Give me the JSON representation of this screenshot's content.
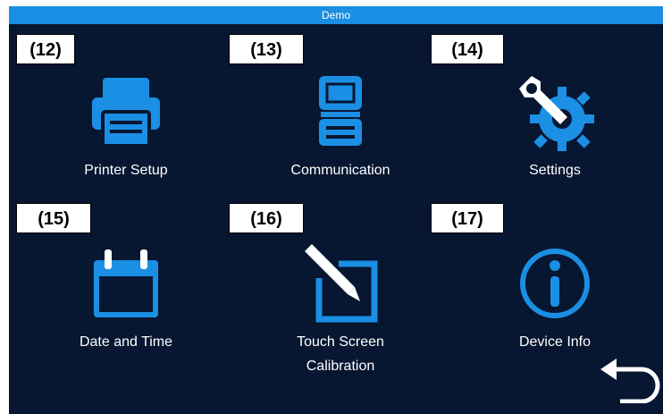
{
  "window": {
    "title": "Demo",
    "accent_color": "#1a8fe3",
    "background_color": "#071631"
  },
  "tiles": [
    {
      "label": "Printer Setup",
      "icon": "printer-icon"
    },
    {
      "label": "Communication",
      "icon": "communication-icon"
    },
    {
      "label": "Settings",
      "icon": "settings-gear-wrench-icon"
    },
    {
      "label": "Date and Time",
      "icon": "calendar-icon"
    },
    {
      "label_line1": "Touch Screen",
      "label_line2": "Calibration",
      "icon": "touch-calibration-pen-icon"
    },
    {
      "label": "Device Info",
      "icon": "info-icon"
    }
  ],
  "badges": [
    "(12)",
    "(13)",
    "(14)",
    "(15)",
    "(16)",
    "(17)"
  ],
  "back": {
    "icon": "back-arrow-icon"
  }
}
